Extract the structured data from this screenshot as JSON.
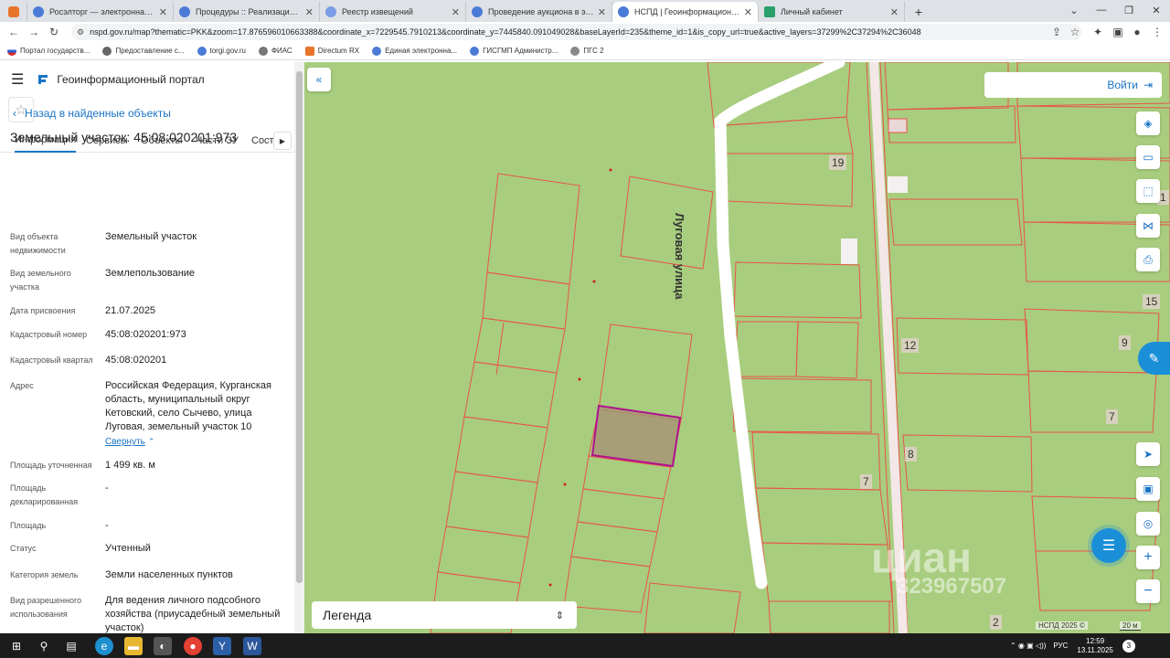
{
  "browser": {
    "tabs": [
      {
        "label": "Росэлторг — электронная торго",
        "color": "#e8742a"
      },
      {
        "label": "Процедуры :: Реализация госим",
        "color": "#4b7bd6"
      },
      {
        "label": "Реестр извещений",
        "color": "#4b7bd6"
      },
      {
        "label": "Проведение аукциона в электр",
        "color": "#4b7bd6"
      },
      {
        "label": "НСПД | Геоинформационный п",
        "color": "#4b7bd6"
      },
      {
        "label": "Личный кабинет",
        "color": "#2aa06a"
      }
    ],
    "new_tab": "+",
    "url": "nspd.gov.ru/map?thematic=PKK&zoom=17.876596010663388&coordinate_x=7229545.7910213&coordinate_y=7445840.091049028&baseLayerId=235&theme_id=1&is_copy_url=true&active_layers=37299%2C37294%2C36048",
    "bookmarks": [
      "Портал государств...",
      "Предоставление с...",
      "torgi.gov.ru",
      "ФИАС",
      "Directum RX",
      "Единая электронна...",
      "ГИСГМП Администр...",
      "ПГС 2"
    ]
  },
  "app": {
    "title": "Геоинформационный портал",
    "back_label": "Назад в найденные объекты",
    "object_title": "Земельный участок: 45:08:020201:973",
    "tabs": [
      "Информация",
      "Сервисы",
      "Объекты",
      "Части ЗУ",
      "Соста"
    ],
    "properties": [
      {
        "label": "Вид объекта недвижимости",
        "value": "Земельный участок"
      },
      {
        "label": "Вид земельного участка",
        "value": "Землепользование"
      },
      {
        "label": "Дата присвоения",
        "value": "21.07.2025"
      },
      {
        "label": "Кадастровый номер",
        "value": "45:08:020201:973"
      },
      {
        "label": "Кадастровый квартал",
        "value": "45:08:020201"
      },
      {
        "label": "Адрес",
        "value": "Российская Федерация, Курганская область, муниципальный округ Кетовский, село Сычево, улица Луговая, земельный участок 10"
      },
      {
        "label": "Площадь уточненная",
        "value": "1 499 кв. м"
      },
      {
        "label": "Площадь декларированная",
        "value": "-"
      },
      {
        "label": "Площадь",
        "value": "-"
      },
      {
        "label": "Статус",
        "value": "Учтенный"
      },
      {
        "label": "Категория земель",
        "value": "Земли населенных пунктов"
      },
      {
        "label": "Вид разрешенного использования",
        "value": "Для ведения личного подсобного хозяйства (приусадебный земельный участок)"
      }
    ],
    "collapse_label": "Свернуть"
  },
  "map": {
    "login_label": "Войти",
    "legend_label": "Легенда",
    "street_label": "Луговая улица",
    "house_numbers": [
      "19",
      "12",
      "9",
      "7",
      "8",
      "7",
      "15",
      "1",
      "2"
    ],
    "watermark_text": "циан",
    "watermark_number": "323967507",
    "attribution": "НСПД 2025 ©",
    "scale_label": "20 м"
  },
  "taskbar": {
    "lang": "РУС",
    "time": "12:59",
    "date": "13.11.2025",
    "notifications": "3"
  },
  "colors": {
    "accent": "#1a73c4",
    "map_bg": "#a8cd7e",
    "parcel_line": "#e8544a",
    "selected_parcel": "#b0128f"
  }
}
